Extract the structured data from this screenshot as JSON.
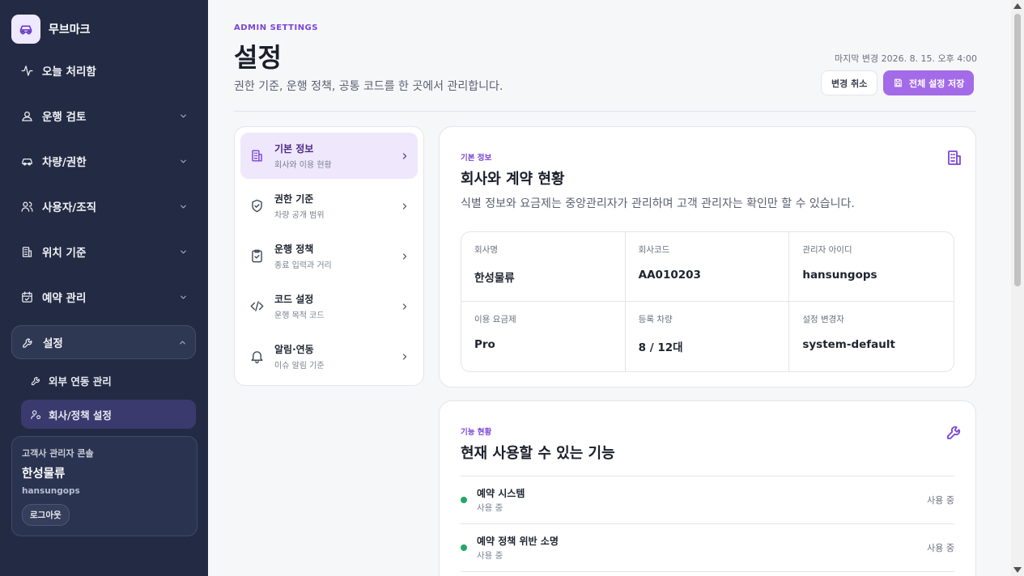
{
  "brand": {
    "name": "무브마크",
    "icon": "car-icon"
  },
  "sidebar": {
    "items": [
      {
        "label": "오늘 처리함",
        "icon": "activity-icon",
        "has_chevron": false
      },
      {
        "label": "운행 검토",
        "icon": "user-pin-icon",
        "has_chevron": true
      },
      {
        "label": "차량/권한",
        "icon": "car-icon",
        "has_chevron": true
      },
      {
        "label": "사용자/조직",
        "icon": "users-icon",
        "has_chevron": true
      },
      {
        "label": "위치 기준",
        "icon": "building-icon",
        "has_chevron": true
      },
      {
        "label": "예약 관리",
        "icon": "calendar-check-icon",
        "has_chevron": true
      },
      {
        "label": "설정",
        "icon": "wrench-icon",
        "has_chevron": true,
        "open": true
      }
    ],
    "sub_items": [
      {
        "label": "외부 연동 관리",
        "icon": "wrench-icon",
        "active": false
      },
      {
        "label": "회사/정책 설정",
        "icon": "user-settings-icon",
        "active": true
      }
    ],
    "user_card": {
      "label": "고객사 관리자 콘솔",
      "company": "한성물류",
      "user_id": "hansungops",
      "logout_label": "로그아웃"
    }
  },
  "header": {
    "eyebrow": "ADMIN SETTINGS",
    "title": "설정",
    "description": "권한 기준, 운행 정책, 공통 코드를 한 곳에서 관리합니다.",
    "last_changed": "마지막 변경 2026. 8. 15. 오후 4:00",
    "cancel_label": "변경 취소",
    "save_label": "전체 설정 저장"
  },
  "settings_nav": [
    {
      "title": "기본 정보",
      "sub": "회사와 이용 현황",
      "icon": "building-icon",
      "active": true
    },
    {
      "title": "권한 기준",
      "sub": "차량 공개 범위",
      "icon": "shield-check-icon",
      "active": false
    },
    {
      "title": "운행 정책",
      "sub": "종료 입력과 거리",
      "icon": "clipboard-check-icon",
      "active": false
    },
    {
      "title": "코드 설정",
      "sub": "운행 목적 코드",
      "icon": "code-icon",
      "active": false
    },
    {
      "title": "알림·연동",
      "sub": "이슈 알림 기준",
      "icon": "bell-icon",
      "active": false
    }
  ],
  "basic_info": {
    "eyebrow": "기본 정보",
    "title": "회사와 계약 현황",
    "description": "식별 정보와 요금제는 중앙관리자가 관리하며 고객 관리자는 확인만 할 수 있습니다.",
    "icon": "building-icon",
    "fields": [
      {
        "label": "회사명",
        "value": "한성물류"
      },
      {
        "label": "회사코드",
        "value": "AA010203"
      },
      {
        "label": "관리자 아이디",
        "value": "hansungops"
      },
      {
        "label": "이용 요금제",
        "value": "Pro"
      },
      {
        "label": "등록 차량",
        "value": "8 / 12대"
      },
      {
        "label": "설정 변경자",
        "value": "system-default"
      }
    ]
  },
  "features": {
    "eyebrow": "기능 현황",
    "title": "현재 사용할 수 있는 기능",
    "icon": "wrench-icon",
    "items": [
      {
        "name": "예약 시스템",
        "sub": "사용 중",
        "state": "사용 중"
      },
      {
        "name": "예약 정책 위반 소명",
        "sub": "사용 중",
        "state": "사용 중"
      }
    ]
  },
  "colors": {
    "sidebar_bg": "#232b44",
    "accent": "#a46be8",
    "accent_text": "#7b45d6",
    "status_active": "#22a86a"
  }
}
